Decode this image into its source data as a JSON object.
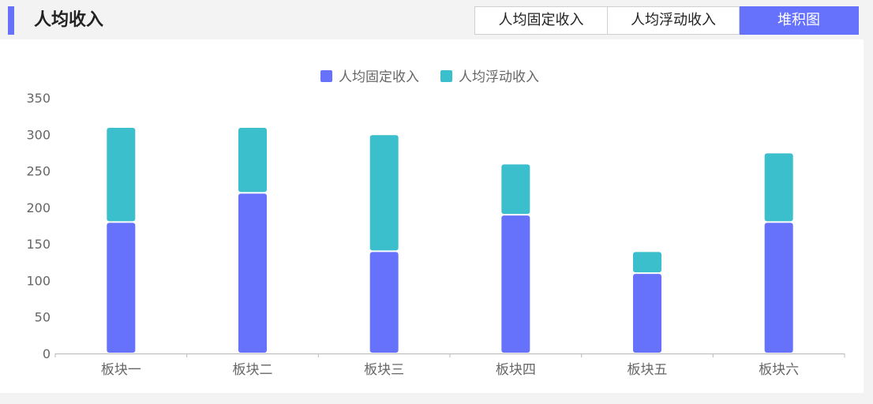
{
  "header": {
    "title": "人均收入",
    "tabs": [
      {
        "label": "人均固定收入",
        "active": false
      },
      {
        "label": "人均浮动收入",
        "active": false
      },
      {
        "label": "堆积图",
        "active": true
      }
    ]
  },
  "colors": {
    "accent": "#6672fb",
    "fixed": "#6672fb",
    "floating": "#3bbfcc",
    "axis": "#b8b8b8",
    "label": "#666666"
  },
  "chart_data": {
    "type": "bar",
    "stacked": true,
    "categories": [
      "板块一",
      "板块二",
      "板块三",
      "板块四",
      "板块五",
      "板块六"
    ],
    "series": [
      {
        "name": "人均固定收入",
        "values": [
          180,
          220,
          140,
          190,
          110,
          180
        ]
      },
      {
        "name": "人均浮动收入",
        "values": [
          130,
          90,
          160,
          70,
          30,
          95
        ]
      }
    ],
    "ylim": [
      0,
      350
    ],
    "yticks": [
      0,
      50,
      100,
      150,
      200,
      250,
      300,
      350
    ],
    "grid": false,
    "legend": "top-center"
  }
}
